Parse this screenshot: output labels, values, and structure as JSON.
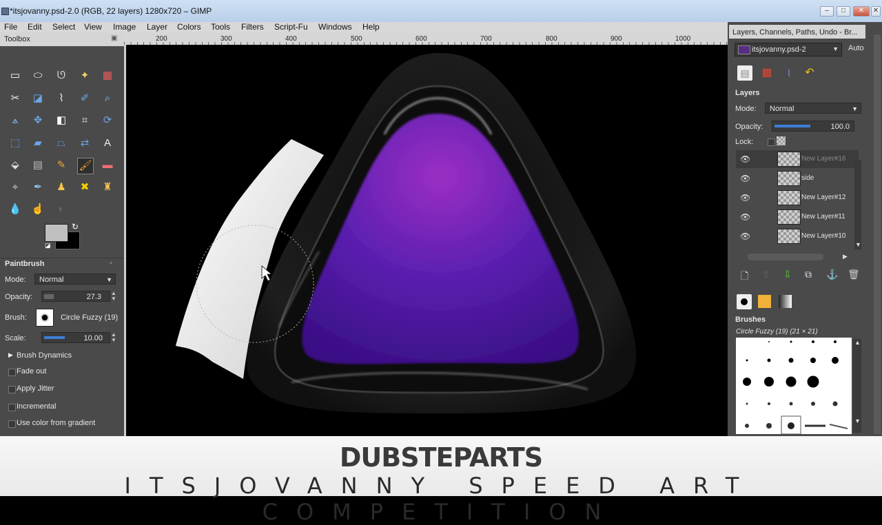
{
  "window": {
    "title": "*itsjovanny.psd-2.0 (RGB, 22 layers) 1280x720 – GIMP"
  },
  "menubar": [
    "File",
    "Edit",
    "Select",
    "View",
    "Image",
    "Layer",
    "Colors",
    "Tools",
    "Filters",
    "Script-Fu",
    "Windows",
    "Help"
  ],
  "ruler": [
    "200",
    "300",
    "400",
    "500",
    "600",
    "700",
    "800",
    "900",
    "1000"
  ],
  "toolbox": {
    "title": "Toolbox",
    "tool_options": {
      "title": "Paintbrush",
      "mode_label": "Mode:",
      "mode_value": "Normal",
      "opacity_label": "Opacity:",
      "opacity_value": "27.3",
      "brush_label": "Brush:",
      "brush_value": "Circle Fuzzy (19)",
      "scale_label": "Scale:",
      "scale_value": "10.00",
      "brush_dynamics": "Brush Dynamics",
      "fade_out": "Fade out",
      "apply_jitter": "Apply Jitter",
      "incremental": "Incremental",
      "use_color_from_gradient": "Use color from gradient"
    }
  },
  "right_panel": {
    "title": "Layers, Channels, Paths, Undo - Br...",
    "image_select": "itsjovanny.psd-2",
    "auto": "Auto",
    "layers_title": "Layers",
    "mode_label": "Mode:",
    "mode_value": "Normal",
    "opacity_label": "Opacity:",
    "opacity_value": "100.0",
    "lock_label": "Lock:",
    "layers": [
      {
        "name": "New Layer#16"
      },
      {
        "name": "side"
      },
      {
        "name": "New Layer#12"
      },
      {
        "name": "New Layer#11"
      },
      {
        "name": "New Layer#10"
      }
    ],
    "brushes_title": "Brushes",
    "brush_info": "Circle Fuzzy (19) (21 × 21)"
  },
  "banner": {
    "brand": "DUBSTEPARTS",
    "tagline": "ITSJOVANNY SPEED ART COMPETITION"
  }
}
